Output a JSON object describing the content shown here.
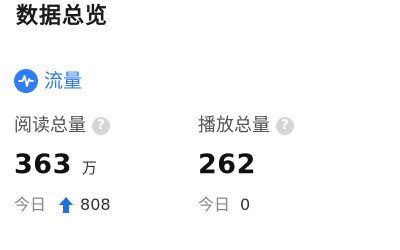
{
  "page": {
    "title": "数据总览"
  },
  "section": {
    "icon": "pulse-icon",
    "title": "流量",
    "accent_color": "#2f7cf6"
  },
  "metrics": [
    {
      "label": "阅读总量",
      "help_icon": "question-icon",
      "value": "363",
      "unit": "万",
      "today_label": "今日",
      "today_trend_icon": "arrow-up-icon",
      "today_trend_color": "#1e6fe8",
      "today_value": "808"
    },
    {
      "label": "播放总量",
      "help_icon": "question-icon",
      "value": "262",
      "unit": "",
      "today_label": "今日",
      "today_value": "0"
    }
  ]
}
